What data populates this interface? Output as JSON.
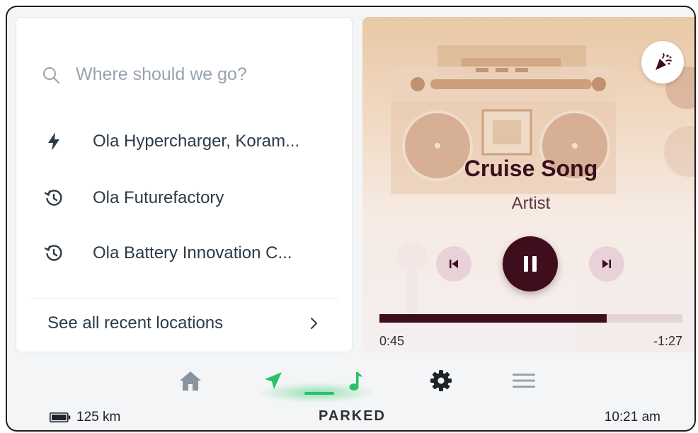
{
  "navigation": {
    "search": {
      "placeholder": "Where should we go?",
      "icon": "search-icon"
    },
    "places": [
      {
        "label": "Ola Hypercharger, Koram...",
        "icon": "lightning-bolt-icon"
      },
      {
        "label": "Ola Futurefactory",
        "icon": "history-icon"
      },
      {
        "label": "Ola Battery Innovation C...",
        "icon": "history-icon"
      }
    ],
    "see_all_label": "See all recent locations"
  },
  "media": {
    "title": "Cruise Song",
    "artist": "Artist",
    "elapsed": "0:45",
    "remaining": "-1:27",
    "progress_fraction": 0.75,
    "state": "playing",
    "accent_color": "#3f0e1c"
  },
  "dock": {
    "items": [
      {
        "name": "home",
        "icon": "home-icon",
        "active": false
      },
      {
        "name": "navigation",
        "icon": "navigation-arrow-icon",
        "active": true
      },
      {
        "name": "music",
        "icon": "music-note-icon",
        "active": true
      },
      {
        "name": "settings",
        "icon": "gear-icon",
        "active": false
      },
      {
        "name": "menu",
        "icon": "hamburger-menu-icon",
        "active": false
      }
    ],
    "active_color": "#28c266"
  },
  "status": {
    "range": "125 km",
    "drive_state": "PARKED",
    "time": "10:21 am"
  }
}
